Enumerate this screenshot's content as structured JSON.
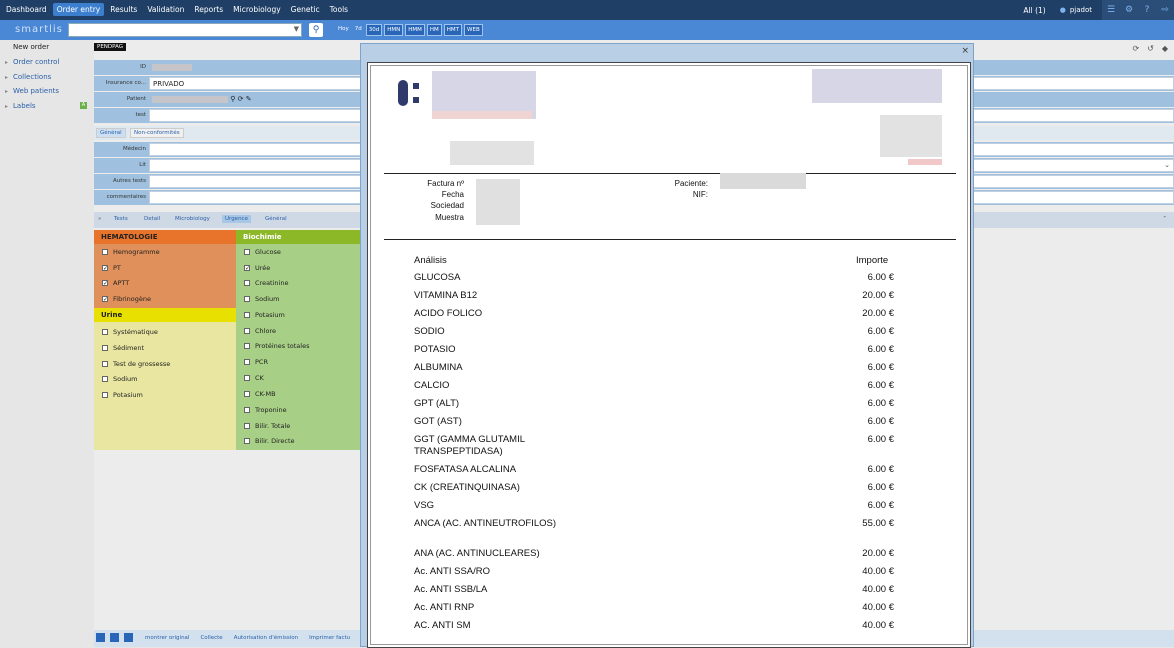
{
  "topnav": {
    "menu": [
      "Dashboard",
      "Order entry",
      "Results",
      "Validation",
      "Reports",
      "Microbiology",
      "Genetic",
      "Tools"
    ],
    "all_label": "All (1)",
    "username": "pjadot"
  },
  "bar2": {
    "logo": "smartlis",
    "ranges": [
      "Hoy",
      "7d",
      "30d",
      "HMN",
      "HMM",
      "HM",
      "HMT",
      "WEB"
    ]
  },
  "sidebar": {
    "items": [
      "New order",
      "Order control",
      "Collections",
      "Web patients",
      "Labels"
    ],
    "labels_badge": "A"
  },
  "form": {
    "status_tag": "PENDPAG",
    "id_label": "ID",
    "insurance_label": "Insurance co...",
    "insurance_value": "PRIVADO",
    "patient_label": "Patient",
    "test_label": "test",
    "tabs": [
      "Général",
      "Non-conformités"
    ],
    "medecin_label": "Médecin",
    "lit_label": "Lit",
    "autres_label": "Autres tests",
    "comment_label": "commentaires"
  },
  "tests_tabs": [
    "Tests",
    "Detail",
    "Microbiology",
    "Urgence",
    "Général"
  ],
  "panels": {
    "hematologie": {
      "title": "HEMATOLOGIE",
      "items": [
        {
          "label": "Hemogramme",
          "checked": ""
        },
        {
          "label": "PT",
          "checked": "✓"
        },
        {
          "label": "APTT",
          "checked": "✓"
        },
        {
          "label": "Fibrinogène",
          "checked": "✓"
        }
      ]
    },
    "urine": {
      "title": "Urine",
      "items": [
        {
          "label": "Systématique",
          "checked": ""
        },
        {
          "label": "Sédiment",
          "checked": ""
        },
        {
          "label": "Test de grossesse",
          "checked": ""
        },
        {
          "label": "Sodium",
          "checked": ""
        },
        {
          "label": "Potasium",
          "checked": ""
        }
      ]
    },
    "biochimie": {
      "title": "Biochimie",
      "items": [
        {
          "label": "Glucose",
          "checked": ""
        },
        {
          "label": "Urée",
          "checked": "✓"
        },
        {
          "label": "Creatinine",
          "checked": ""
        },
        {
          "label": "Sodium",
          "checked": ""
        },
        {
          "label": "Potasium",
          "checked": ""
        },
        {
          "label": "Chlore",
          "checked": ""
        },
        {
          "label": "Protéines totales",
          "checked": ""
        },
        {
          "label": "PCR",
          "checked": ""
        },
        {
          "label": "CK",
          "checked": ""
        },
        {
          "label": "CK-MB",
          "checked": ""
        },
        {
          "label": "Troponine",
          "checked": ""
        },
        {
          "label": "Bilir. Totale",
          "checked": ""
        },
        {
          "label": "Bilir. Directe",
          "checked": ""
        }
      ]
    }
  },
  "footer_links": [
    "montrer original",
    "Collecte",
    "Autorisation d'émission",
    "Imprimer factu"
  ],
  "invoice": {
    "factura_label": "Factura nº",
    "fecha_label": "Fecha",
    "sociedad_label": "Sociedad",
    "muestra_label": "Muestra",
    "paciente_label": "Paciente:",
    "nif_label": "NIF:",
    "col_analisis": "Análisis",
    "col_importe": "Importe",
    "rows": [
      {
        "name": "GLUCOSA",
        "amount": "6.00 €"
      },
      {
        "name": "VITAMINA B12",
        "amount": "20.00 €"
      },
      {
        "name": "ACIDO FOLICO",
        "amount": "20.00 €"
      },
      {
        "name": "SODIO",
        "amount": "6.00 €"
      },
      {
        "name": "POTASIO",
        "amount": "6.00 €"
      },
      {
        "name": "ALBUMINA",
        "amount": "6.00 €"
      },
      {
        "name": "CALCIO",
        "amount": "6.00 €"
      },
      {
        "name": "GPT (ALT)",
        "amount": "6.00 €"
      },
      {
        "name": "GOT (AST)",
        "amount": "6.00 €"
      },
      {
        "name": "GGT (GAMMA GLUTAMIL TRANSPEPTIDASA)",
        "amount": "6.00 €"
      },
      {
        "name": "FOSFATASA ALCALINA",
        "amount": "6.00 €"
      },
      {
        "name": "CK (CREATINQUINASA)",
        "amount": "6.00 €"
      },
      {
        "name": "VSG",
        "amount": "6.00 €"
      },
      {
        "name": "ANCA (AC. ANTINEUTROFILOS)",
        "amount": "55.00 €"
      },
      {
        "name": "ANA (AC. ANTINUCLEARES)",
        "amount": "20.00 €"
      },
      {
        "name": "Ac. ANTI SSA/RO",
        "amount": "40.00 €"
      },
      {
        "name": "Ac. ANTI SSB/LA",
        "amount": "40.00 €"
      },
      {
        "name": "Ac. ANTI RNP",
        "amount": "40.00 €"
      },
      {
        "name": "AC. ANTI SM",
        "amount": "40.00 €"
      }
    ]
  },
  "colors": {
    "topnav": "#1f3f66",
    "bar2": "#4a88d6",
    "hematologie": "#e8732a",
    "urine": "#e8e000",
    "biochimie": "#8cb828"
  }
}
